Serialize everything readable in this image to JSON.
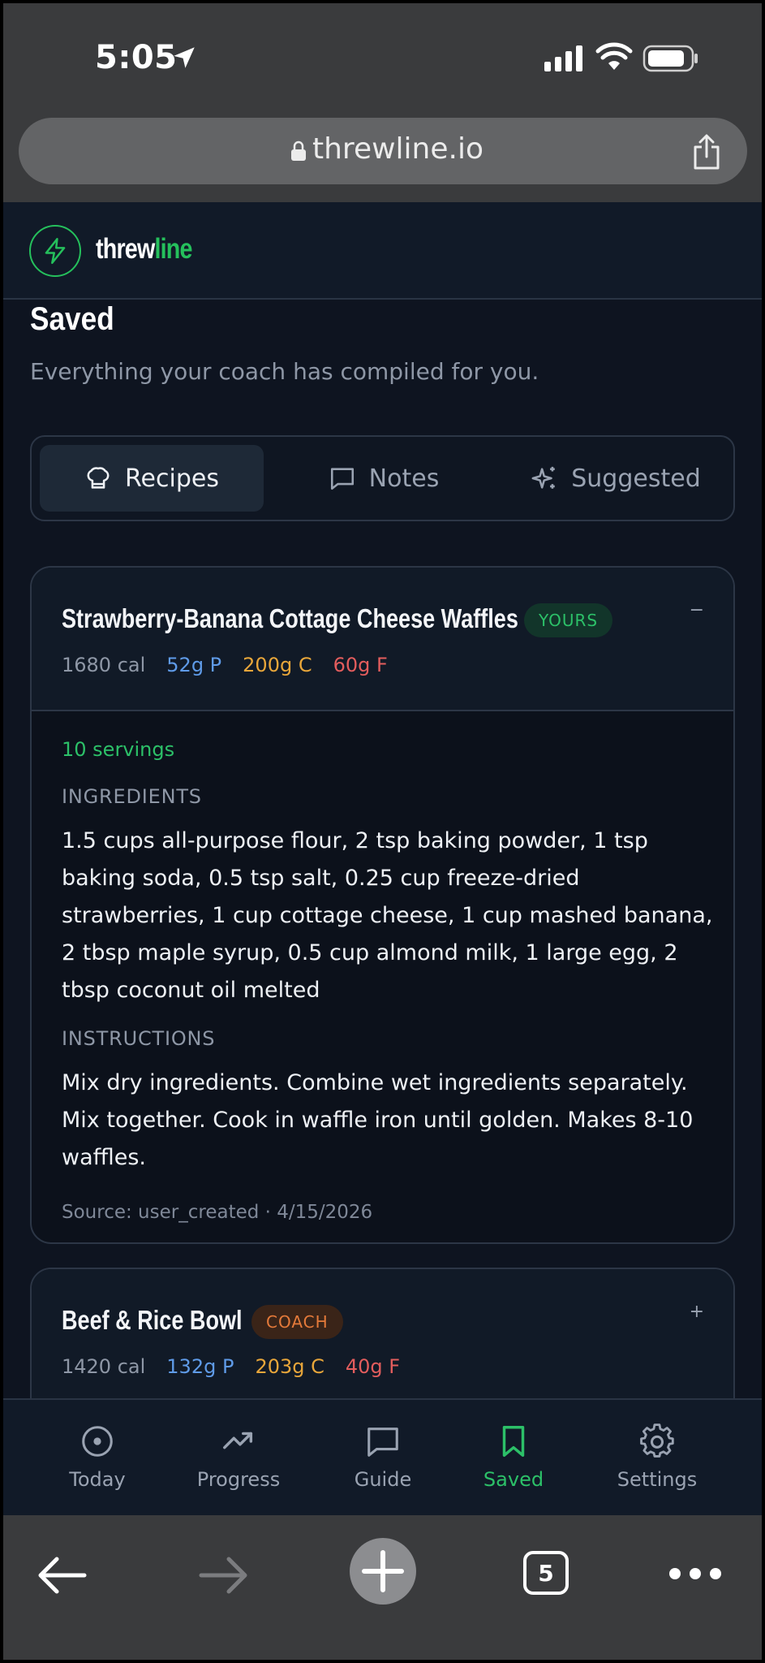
{
  "status_bar": {
    "time": "5:05"
  },
  "browser": {
    "url": "threwline.io",
    "tabs_count": "5"
  },
  "app": {
    "brand": {
      "part1": "threw",
      "part2": "line",
      "accent": "#25c05c"
    },
    "page_title": "Saved",
    "page_subtitle": "Everything your coach has compiled for you.",
    "segments": [
      {
        "label": "Recipes",
        "icon": "chef-hat-icon",
        "active": true
      },
      {
        "label": "Notes",
        "icon": "chat-bubble-icon",
        "active": false
      },
      {
        "label": "Suggested",
        "icon": "sparkles-icon",
        "active": false
      }
    ],
    "recipes": [
      {
        "title": "Strawberry-Banana Cottage Cheese Waffles",
        "badge": "YOURS",
        "toggle": "−",
        "cal": "1680 cal",
        "protein": "52g P",
        "carbs": "200g C",
        "fat": "60g F",
        "servings": "10 servings",
        "ingredients_label": "INGREDIENTS",
        "ingredients": "1.5 cups all-purpose flour, 2 tsp baking powder, 1 tsp baking soda, 0.5 tsp salt, 0.25 cup freeze-dried strawberries, 1 cup cottage cheese, 1 cup mashed banana, 2 tbsp maple syrup, 0.5 cup almond milk, 1 large egg, 2 tbsp coconut oil melted",
        "instructions_label": "INSTRUCTIONS",
        "instructions": "Mix dry ingredients. Combine wet ingredients separately. Mix together. Cook in waffle iron until golden. Makes 8-10 waffles.",
        "source": "Source: user_created · 4/15/2026"
      },
      {
        "title": "Beef & Rice Bowl",
        "badge": "COACH",
        "toggle": "+",
        "cal": "1420 cal",
        "protein": "132g P",
        "carbs": "203g C",
        "fat": "40g F"
      }
    ]
  },
  "tabbar": [
    {
      "label": "Today",
      "icon": "target-icon",
      "active": false
    },
    {
      "label": "Progress",
      "icon": "trending-up-icon",
      "active": false
    },
    {
      "label": "Guide",
      "icon": "chat-bubble-icon",
      "active": false
    },
    {
      "label": "Saved",
      "icon": "bookmark-icon",
      "active": true
    },
    {
      "label": "Settings",
      "icon": "gear-icon",
      "active": false
    }
  ]
}
